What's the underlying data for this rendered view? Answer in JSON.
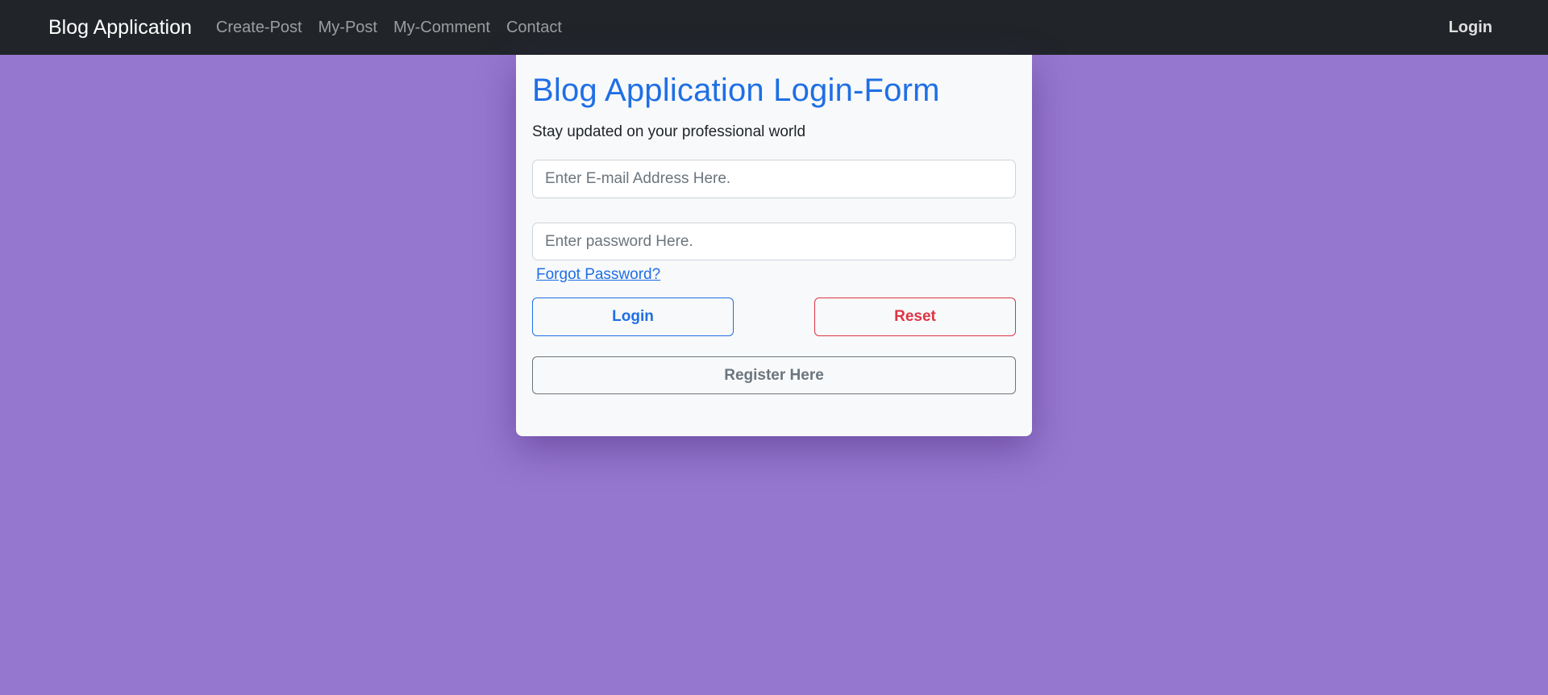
{
  "navbar": {
    "brand": "Blog Application",
    "links": [
      {
        "label": "Create-Post"
      },
      {
        "label": "My-Post"
      },
      {
        "label": "My-Comment"
      },
      {
        "label": "Contact"
      }
    ],
    "login_label": "Login"
  },
  "form": {
    "title": "Blog Application Login-Form",
    "subtitle": "Stay updated on your professional world",
    "email": {
      "value": "",
      "placeholder": "Enter E-mail Address Here."
    },
    "password": {
      "value": "",
      "placeholder": "Enter password Here."
    },
    "forgot_label": "Forgot Password?",
    "login_button": "Login",
    "reset_button": "Reset",
    "register_button": "Register Here"
  },
  "colors": {
    "background": "#9677cf",
    "navbar": "#212529",
    "primary": "#1f6fe5",
    "danger": "#dc3545",
    "secondary": "#6c757d",
    "card": "#f8f9fa"
  }
}
